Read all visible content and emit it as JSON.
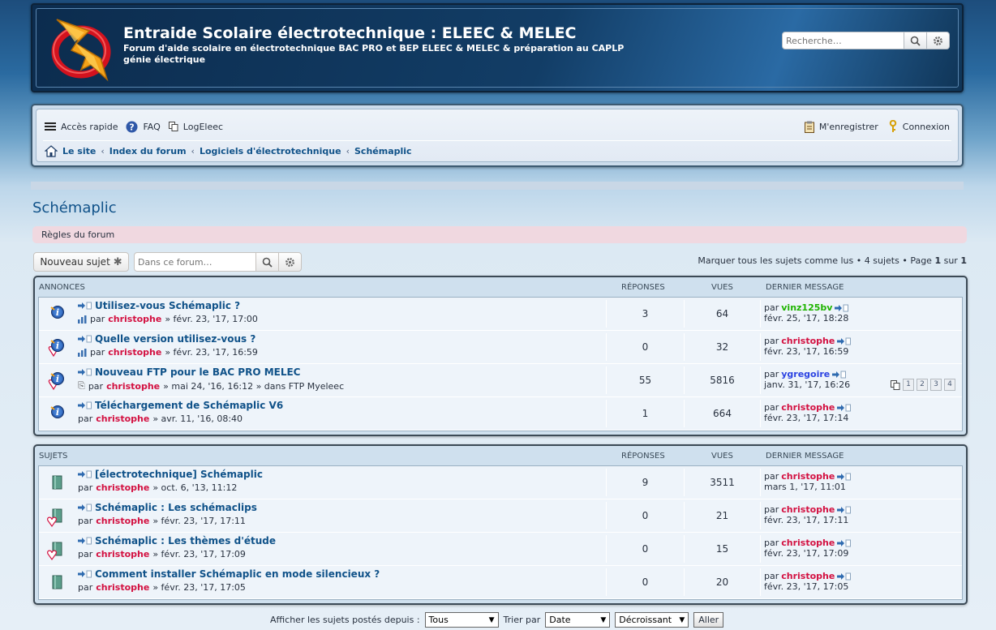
{
  "header": {
    "title": "Entraide Scolaire électrotechnique : ELEEC & MELEC",
    "description": "Forum d'aide scolaire en électrotechnique BAC PRO et BEP ELEEC & MELEC & préparation au CAPLP génie électrique",
    "search_placeholder": "Recherche…"
  },
  "nav": {
    "quick_access": "Accès rapide",
    "faq": "FAQ",
    "logeleec": "LogEleec",
    "register": "M'enregistrer",
    "login": "Connexion"
  },
  "breadcrumbs": [
    "Le site",
    "Index du forum",
    "Logiciels d'électrotechnique",
    "Schémaplic"
  ],
  "page": {
    "title": "Schémaplic",
    "rules": "Règles du forum",
    "new_topic": "Nouveau sujet",
    "forum_search_placeholder": "Dans ce forum…",
    "mark_read": "Marquer tous les sujets comme lus",
    "topics_count": "4 sujets",
    "page_label": "Page",
    "page_current": "1",
    "page_of": "sur",
    "page_total": "1"
  },
  "columns": {
    "replies": "RÉPONSES",
    "views": "VUES",
    "last_post": "DERNIER MESSAGE"
  },
  "announcements": {
    "heading": "ANNONCES",
    "rows": [
      {
        "title": "Utilisez-vous Schémaplic ?",
        "by": "par",
        "author": "christophe",
        "date": "» févr. 23, '17, 17:00",
        "extra": "",
        "replies": "3",
        "views": "64",
        "last_by": "par",
        "last_author": "vinz125bv",
        "last_color": "green",
        "last_date": "févr. 25, '17, 18:28",
        "icon": "info-icon",
        "poll": true
      },
      {
        "title": "Quelle version utilisez-vous ?",
        "by": "par",
        "author": "christophe",
        "date": "» févr. 23, '17, 16:59",
        "extra": "",
        "replies": "0",
        "views": "32",
        "last_by": "par",
        "last_author": "christophe",
        "last_color": "red",
        "last_date": "févr. 23, '17, 16:59",
        "icon": "info-posted-icon",
        "poll": true
      },
      {
        "title": "Nouveau FTP pour le BAC PRO MELEC",
        "by": "par",
        "author": "christophe",
        "date": "» mai 24, '16, 16:12 » dans FTP Myeleec",
        "extra": "attach",
        "replies": "55",
        "views": "5816",
        "last_by": "par",
        "last_author": "ygregoire",
        "last_color": "blue",
        "last_date": "janv. 31, '17, 16:26",
        "icon": "info-posted-icon",
        "poll": false,
        "pages": [
          "1",
          "2",
          "3",
          "4"
        ]
      },
      {
        "title": "Téléchargement de Schémaplic V6",
        "by": "par",
        "author": "christophe",
        "date": "» avr. 11, '16, 08:40",
        "extra": "",
        "replies": "1",
        "views": "664",
        "last_by": "par",
        "last_author": "christophe",
        "last_color": "red",
        "last_date": "févr. 23, '17, 17:14",
        "icon": "info-icon",
        "poll": false
      }
    ]
  },
  "topics": {
    "heading": "SUJETS",
    "rows": [
      {
        "title": "[électrotechnique] Schémaplic",
        "by": "par",
        "author": "christophe",
        "date": "» oct. 6, '13, 11:12",
        "replies": "9",
        "views": "3511",
        "last_by": "par",
        "last_author": "christophe",
        "last_color": "red",
        "last_date": "mars 1, '17, 11:01",
        "icon": "topic-icon"
      },
      {
        "title": "Schémaplic : Les schémaclips",
        "by": "par",
        "author": "christophe",
        "date": "» févr. 23, '17, 17:11",
        "replies": "0",
        "views": "21",
        "last_by": "par",
        "last_author": "christophe",
        "last_color": "red",
        "last_date": "févr. 23, '17, 17:11",
        "icon": "topic-posted-icon"
      },
      {
        "title": "Schémaplic : Les thèmes d'étude",
        "by": "par",
        "author": "christophe",
        "date": "» févr. 23, '17, 17:09",
        "replies": "0",
        "views": "15",
        "last_by": "par",
        "last_author": "christophe",
        "last_color": "red",
        "last_date": "févr. 23, '17, 17:09",
        "icon": "topic-posted-icon"
      },
      {
        "title": "Comment installer Schémaplic en mode silencieux ?",
        "by": "par",
        "author": "christophe",
        "date": "» févr. 23, '17, 17:05",
        "replies": "0",
        "views": "20",
        "last_by": "par",
        "last_author": "christophe",
        "last_color": "red",
        "last_date": "févr. 23, '17, 17:05",
        "icon": "topic-icon"
      }
    ]
  },
  "sort": {
    "show_since_label": "Afficher les sujets postés depuis :",
    "show_since_value": "Tous",
    "sort_by_label": "Trier par",
    "sort_by_value": "Date",
    "order_value": "Décroissant",
    "go": "Aller"
  },
  "colors": {
    "link": "#105289",
    "author_red": "#d31141",
    "user_green": "#1eb400",
    "user_blue": "#2c43e2"
  }
}
